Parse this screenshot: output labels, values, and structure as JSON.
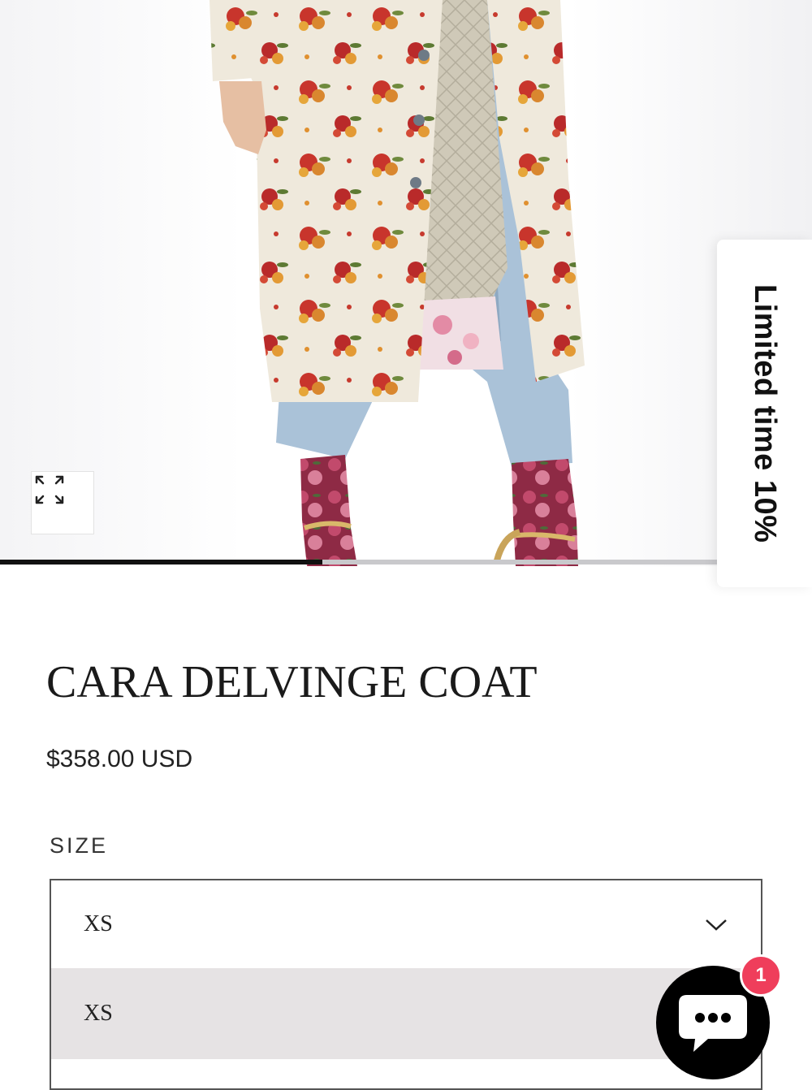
{
  "product_image": {
    "alt": "Model wearing floral print long coat over light blue jeans with floral socks",
    "gallery_progress": 0.45
  },
  "icons": {
    "zoom": "expand-arrows-icon",
    "dropdown": "chevron-down-icon",
    "chat": "chat-bubble-icon"
  },
  "promo": {
    "text": "Limited time 10%"
  },
  "product": {
    "title": "CARA DELVINGE COAT",
    "price": "$358.00 USD"
  },
  "size": {
    "label": "SIZE",
    "selected": "XS",
    "options": [
      "XS"
    ]
  },
  "chat": {
    "badge_count": "1"
  },
  "colors": {
    "badge": "#ef3e5b",
    "option_highlight": "#e6e3e4",
    "chat_bg": "#000000"
  }
}
